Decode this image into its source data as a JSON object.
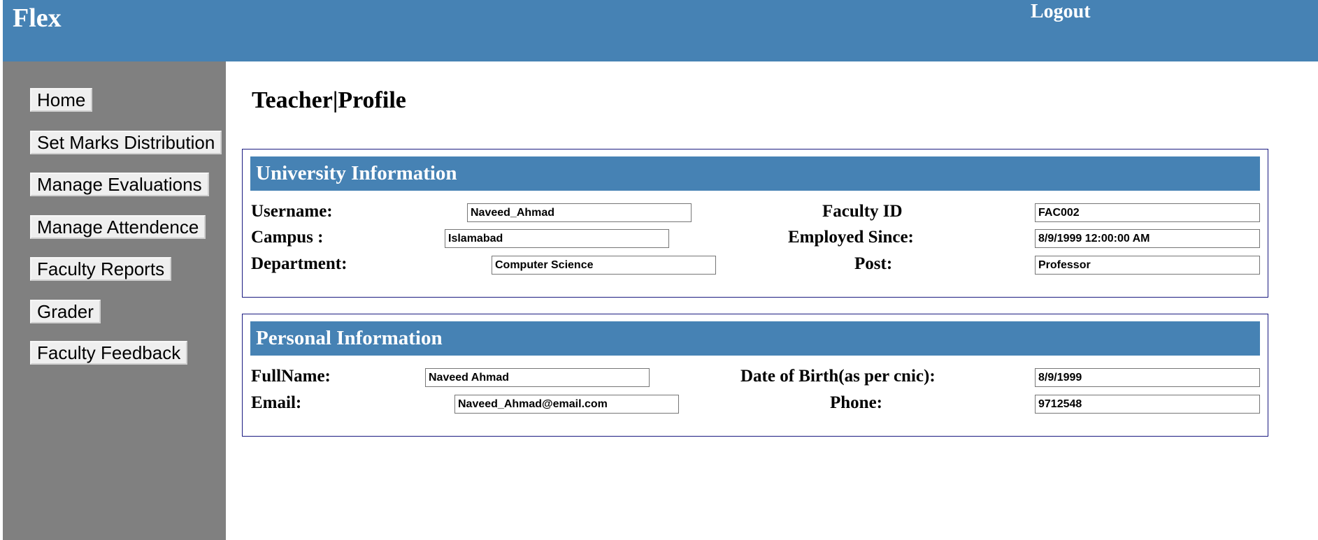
{
  "header": {
    "brand": "Flex",
    "logout_label": "Logout"
  },
  "sidebar": {
    "items": [
      {
        "label": "Home"
      },
      {
        "label": "Set Marks Distribution"
      },
      {
        "label": "Manage Evaluations"
      },
      {
        "label": "Manage Attendence"
      },
      {
        "label": "Faculty Reports"
      },
      {
        "label": "Grader"
      },
      {
        "label": "Faculty Feedback"
      }
    ]
  },
  "main": {
    "title": "Teacher|Profile",
    "university": {
      "heading": "University Information",
      "username_label": "Username:",
      "username_value": "Naveed_Ahmad",
      "campus_label": "Campus :",
      "campus_value": "Islamabad",
      "department_label": "Department:",
      "department_value": "Computer Science",
      "faculty_id_label": "Faculty ID",
      "faculty_id_value": "FAC002",
      "employed_since_label": "Employed Since:",
      "employed_since_value": "8/9/1999 12:00:00 AM",
      "post_label": "Post:",
      "post_value": "Professor"
    },
    "personal": {
      "heading": "Personal Information",
      "fullname_label": "FullName:",
      "fullname_value": "Naveed Ahmad",
      "email_label": "Email:",
      "email_value": "Naveed_Ahmad@email.com",
      "dob_label": "Date of Birth(as per cnic):",
      "dob_value": "8/9/1999",
      "phone_label": "Phone:",
      "phone_value": "9712548"
    }
  },
  "colors": {
    "header_bg": "#4682b4",
    "sidebar_bg": "#808080",
    "panel_border": "#1a1a80"
  }
}
